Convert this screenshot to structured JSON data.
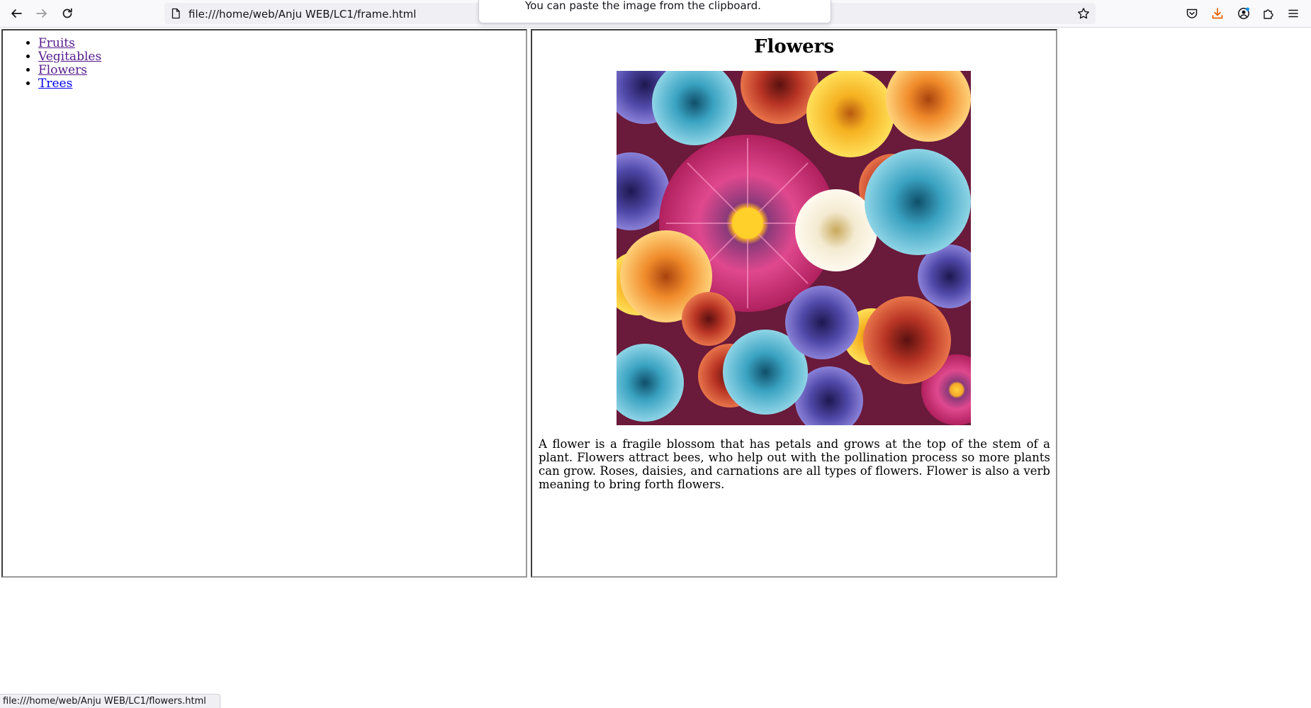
{
  "browser": {
    "url": "file:///home/web/Anju WEB/LC1/frame.html",
    "paste_tooltip": "You can paste the image from the clipboard.",
    "status_url": "file:///home/web/Anju WEB/LC1/flowers.html",
    "toolbar_icons": [
      "back-icon",
      "forward-icon",
      "reload-icon",
      "page-icon",
      "bookmark-star-icon",
      "pocket-icon",
      "downloads-icon",
      "account-icon",
      "extensions-icon",
      "menu-icon"
    ],
    "accent_color": "#e66000"
  },
  "nav": {
    "items": [
      {
        "label": "Fruits"
      },
      {
        "label": "Vegitables"
      },
      {
        "label": "Flowers"
      },
      {
        "label": "Trees"
      }
    ]
  },
  "content": {
    "title": "Flowers",
    "image": "colorful-flowers-image",
    "paragraph": "A flower is a fragile blossom that has petals and grows at the top of the stem of a plant. Flowers attract bees, who help out with the pollination process so more plants can grow. Roses, daisies, and carnations are all types of flowers. Flower is also a verb meaning to bring forth flowers."
  }
}
